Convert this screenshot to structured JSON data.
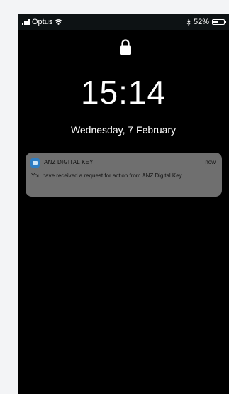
{
  "status_bar": {
    "carrier": "Optus",
    "battery_percent": "52%",
    "battery_level": 0.52,
    "icons": [
      "signal-icon",
      "wifi-icon",
      "bluetooth-icon",
      "battery-icon"
    ]
  },
  "lock_screen": {
    "lock_icon": "lock-icon",
    "time": "15:14",
    "date": "Wednesday, 7 February"
  },
  "notification": {
    "app_icon": "anz-app-icon",
    "app_name": "ANZ DIGITAL KEY",
    "time": "now",
    "body": "You have received a request for action from ANZ Digital Key."
  }
}
